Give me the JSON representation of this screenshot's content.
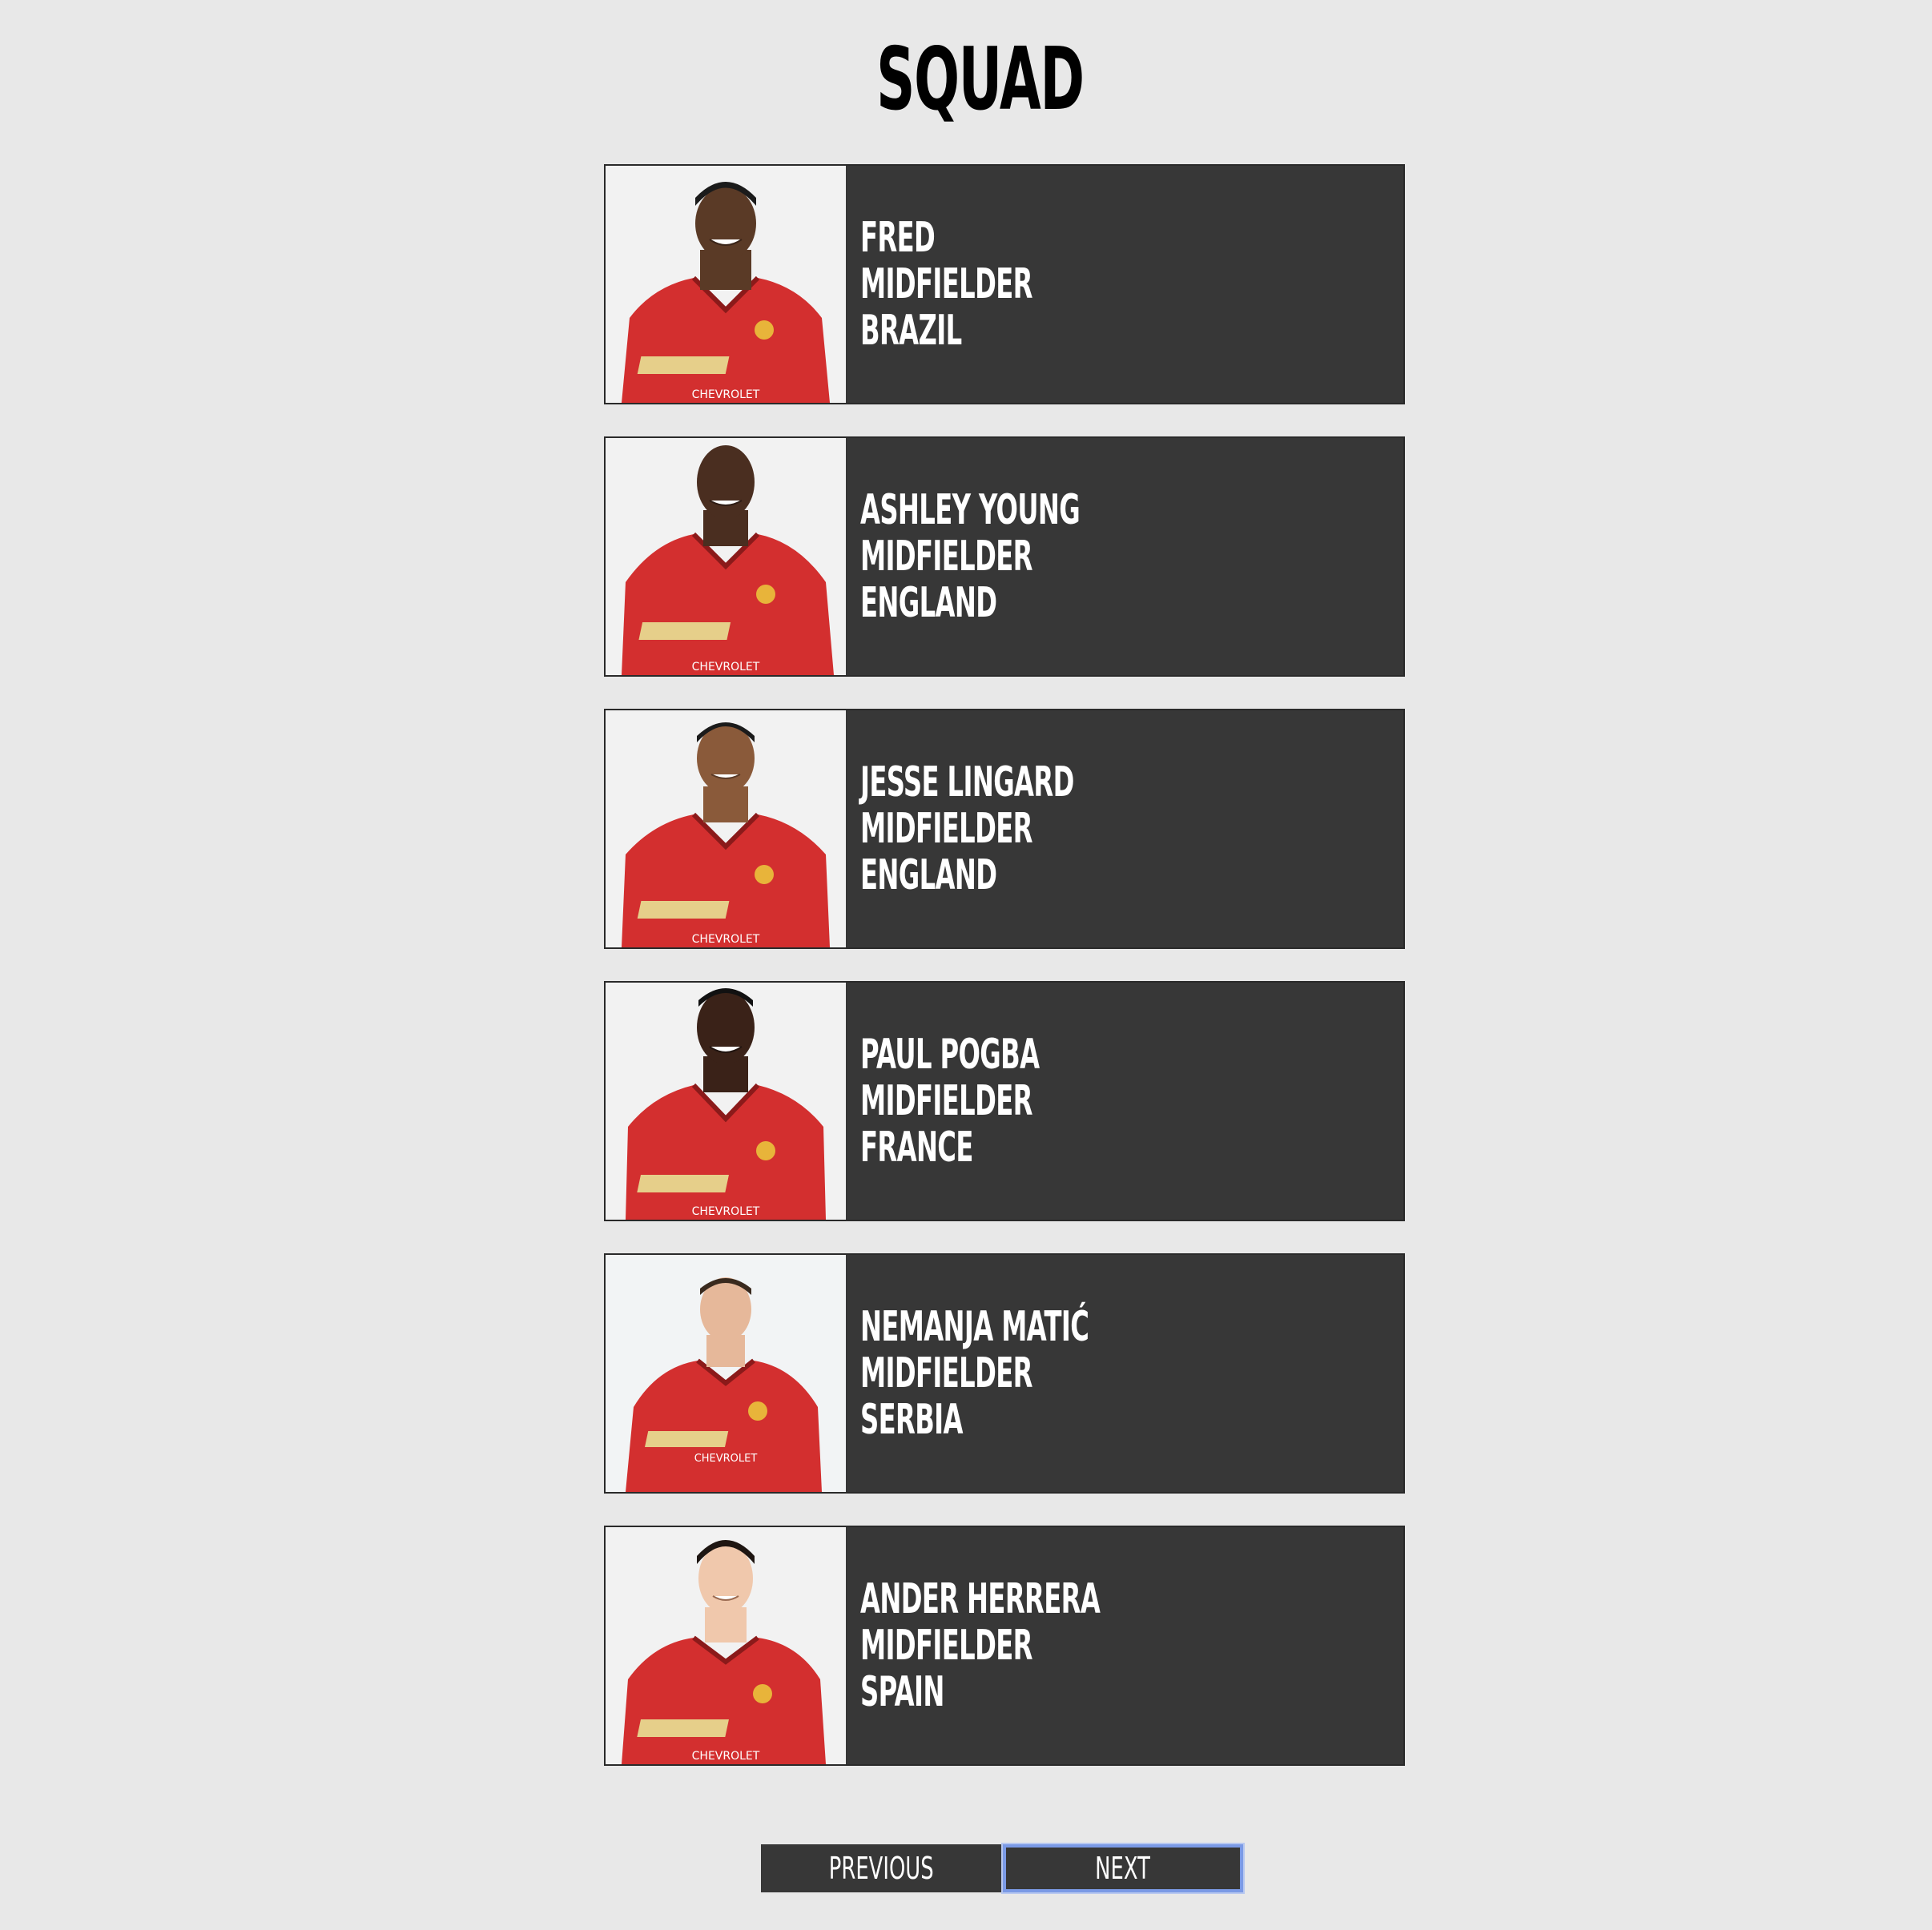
{
  "page": {
    "title": "SQUAD"
  },
  "players": [
    {
      "name": "FRED",
      "position": "MIDFIELDER",
      "country": "BRAZIL",
      "sponsor": "CHEVROLET"
    },
    {
      "name": "ASHLEY YOUNG",
      "position": "MIDFIELDER",
      "country": "ENGLAND",
      "sponsor": "CHEVROLET"
    },
    {
      "name": "JESSE LINGARD",
      "position": "MIDFIELDER",
      "country": "ENGLAND",
      "sponsor": "CHEVROLET"
    },
    {
      "name": "PAUL POGBA",
      "position": "MIDFIELDER",
      "country": "FRANCE",
      "sponsor": "CHEVROLET"
    },
    {
      "name": "NEMANJA MATIĆ",
      "position": "MIDFIELDER",
      "country": "SERBIA",
      "sponsor": "CHEVROLET"
    },
    {
      "name": "ANDER HERRERA",
      "position": "MIDFIELDER",
      "country": "SPAIN",
      "sponsor": "CHEVROLET"
    }
  ],
  "pagination": {
    "previous_label": "PREVIOUS",
    "next_label": "NEXT"
  },
  "colors": {
    "background": "#e8e8e8",
    "card": "#373737",
    "shirt": "#d32f2f",
    "focus_ring": "#7b9ae6"
  }
}
